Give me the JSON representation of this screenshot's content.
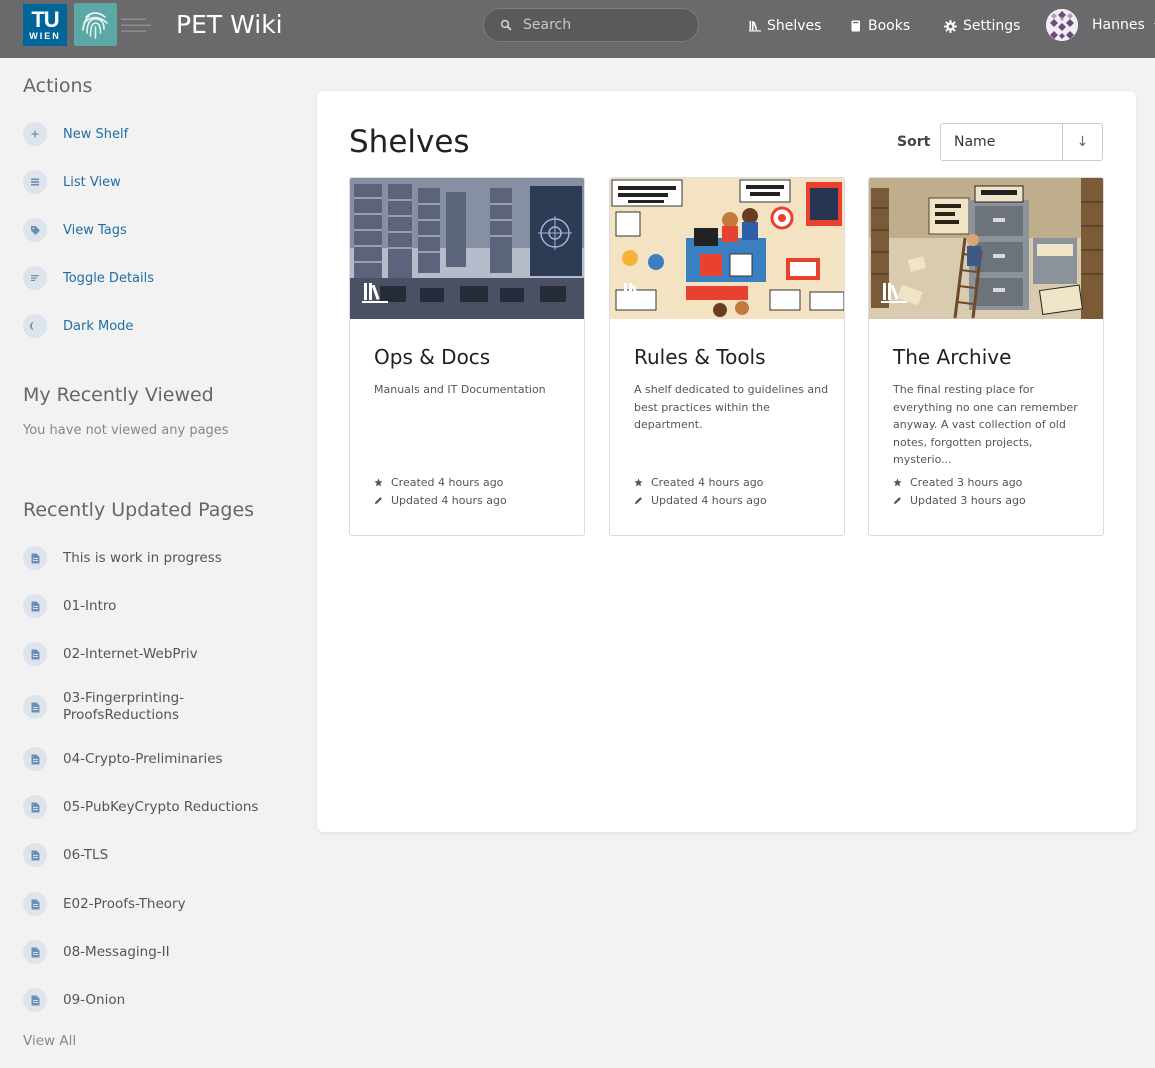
{
  "header": {
    "logo_text_line1": "TU",
    "logo_text_line2": "WIEN",
    "app_name": "PET Wiki",
    "search_placeholder": "Search",
    "nav": [
      {
        "label": "Shelves",
        "icon": "shelves-icon"
      },
      {
        "label": "Books",
        "icon": "book-icon"
      },
      {
        "label": "Settings",
        "icon": "gear-icon"
      }
    ],
    "user_name": "Hannes"
  },
  "sidebar": {
    "actions_title": "Actions",
    "actions": [
      {
        "label": "New Shelf",
        "icon": "plus-icon"
      },
      {
        "label": "List View",
        "icon": "list-icon"
      },
      {
        "label": "View Tags",
        "icon": "tag-icon"
      },
      {
        "label": "Toggle Details",
        "icon": "toggle-details-icon"
      },
      {
        "label": "Dark Mode",
        "icon": "moon-icon"
      }
    ],
    "recent_title": "My Recently Viewed",
    "recent_empty": "You have not viewed any pages",
    "updated_title": "Recently Updated Pages",
    "updated_pages": [
      {
        "label": "This is work in progress"
      },
      {
        "label": "01-Intro"
      },
      {
        "label": "02-Internet-WebPriv"
      },
      {
        "label": "03-Fingerprinting-ProofsReductions"
      },
      {
        "label": "04-Crypto-Preliminaries"
      },
      {
        "label": "05-PubKeyCrypto Reductions"
      },
      {
        "label": "06-TLS"
      },
      {
        "label": "E02-Proofs-Theory"
      },
      {
        "label": "08-Messaging-II"
      },
      {
        "label": "09-Onion"
      }
    ],
    "view_all": "View All"
  },
  "main": {
    "title": "Shelves",
    "sort_label": "Sort",
    "sort_value": "Name",
    "sort_direction": "↓",
    "shelves": [
      {
        "name": "Ops & Docs",
        "description": "Manuals and IT Documentation",
        "created": "Created 4 hours ago",
        "updated": "Updated 4 hours ago"
      },
      {
        "name": "Rules & Tools",
        "description": "A shelf dedicated to guidelines and best practices within the department.",
        "created": "Created 4 hours ago",
        "updated": "Updated 4 hours ago"
      },
      {
        "name": "The Archive",
        "description": "The final resting place for everything no one can remember anyway. A vast collection of old notes, forgotten projects, mysterio...",
        "created": "Created 3 hours ago",
        "updated": "Updated 3 hours ago"
      }
    ]
  },
  "colors": {
    "header_bg": "#6a6a6c",
    "link": "#206ea7",
    "tu_blue": "#006699",
    "fingerprint_teal": "#5ba8a5"
  }
}
